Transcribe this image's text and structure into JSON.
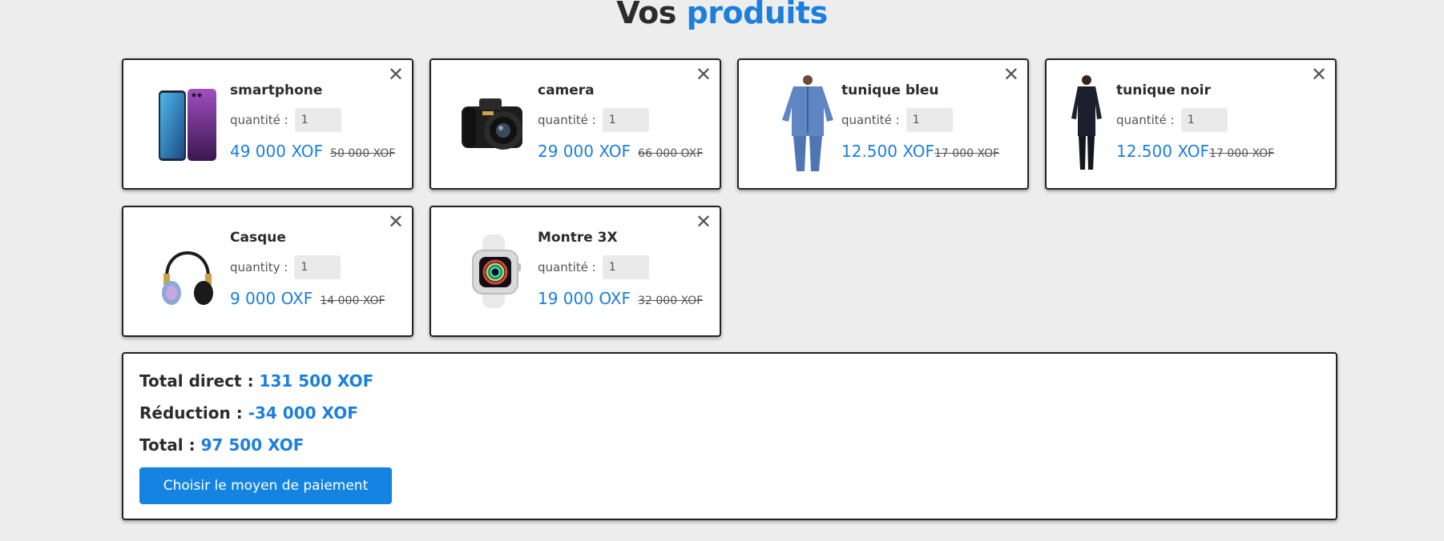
{
  "title": {
    "prefix": "Vos",
    "accent": "produits"
  },
  "products": [
    {
      "name": "smartphone",
      "qty_label": "quantité :",
      "qty": "1",
      "price": "49 000 XOF",
      "old_price": "50 000 XOF",
      "image": "smartphone-image",
      "close": "✕"
    },
    {
      "name": "camera",
      "qty_label": "quantité :",
      "qty": "1",
      "price": "29 000 XOF",
      "old_price": "66 000 OXF",
      "image": "camera-image",
      "close": "✕"
    },
    {
      "name": "tunique bleu",
      "qty_label": "quantité :",
      "qty": "1",
      "price": "12.500 XOF",
      "old_price": "17 000 XOF",
      "image": "blue-tunic-image",
      "close": "✕"
    },
    {
      "name": "tunique noir",
      "qty_label": "quantité :",
      "qty": "1",
      "price": "12.500 XOF",
      "old_price": "17 000 XOF",
      "image": "black-tunic-image",
      "close": "✕"
    },
    {
      "name": "Casque",
      "qty_label": "quantity :",
      "qty": "1",
      "price": "9 000 OXF",
      "old_price": "14 000 XOF",
      "image": "headphones-image",
      "close": "✕"
    },
    {
      "name": "Montre 3X",
      "qty_label": "quantité :",
      "qty": "1",
      "price": "19 000 OXF",
      "old_price": "32 000 XOF",
      "image": "smartwatch-image",
      "close": "✕"
    }
  ],
  "summary": {
    "direct_label": "Total direct :",
    "direct_value": "131 500 XOF",
    "reduction_label": "Réduction :",
    "reduction_value": "-34 000 XOF",
    "total_label": "Total :",
    "total_value": "97 500 XOF",
    "pay_button": "Choisir le moyen de paiement"
  },
  "colors": {
    "accent": "#1a7fdd",
    "button": "#1483e2",
    "background": "#ededed"
  }
}
